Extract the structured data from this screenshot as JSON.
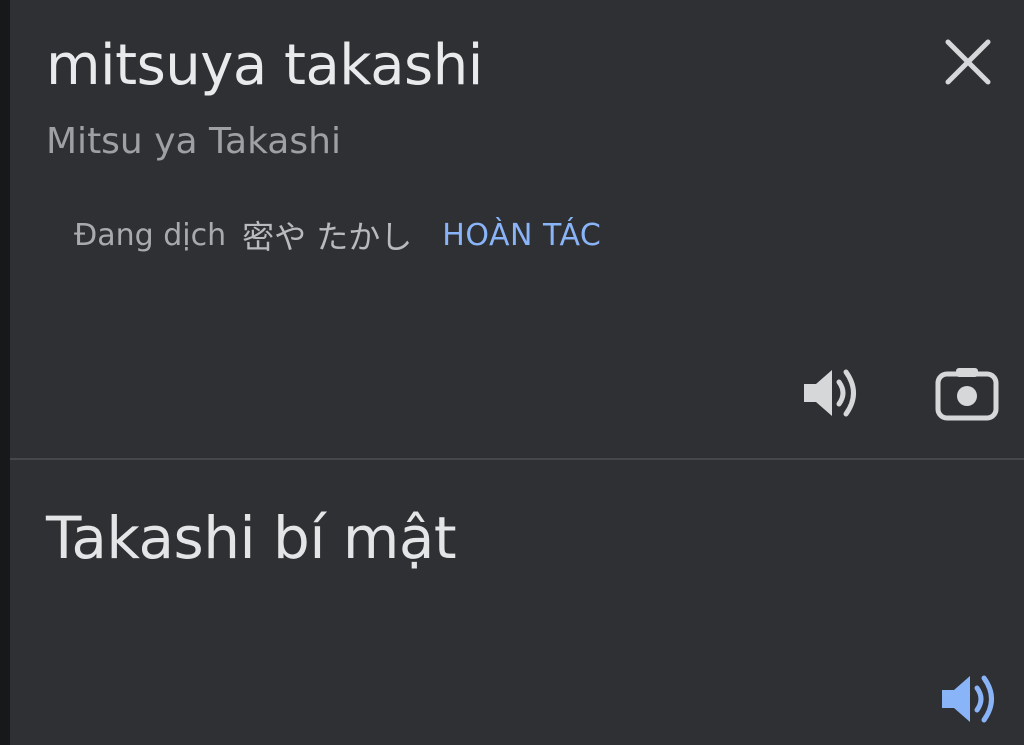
{
  "source": {
    "text": "mitsuya takashi",
    "transliteration": "Mitsu ya Takashi",
    "translating_label": "Đang dịch",
    "translating_text": "密や たかし",
    "undo_label": "HOÀN TÁC"
  },
  "target": {
    "text": "Takashi bí mật"
  },
  "icons": {
    "close": "close-icon",
    "source_speaker": "speaker-icon",
    "camera": "camera-icon",
    "target_speaker": "speaker-icon"
  },
  "colors": {
    "background": "#2f3033",
    "accent": "#8ab4f8",
    "primary_text": "#e9eaeb",
    "secondary_text": "#9ea0a4"
  }
}
